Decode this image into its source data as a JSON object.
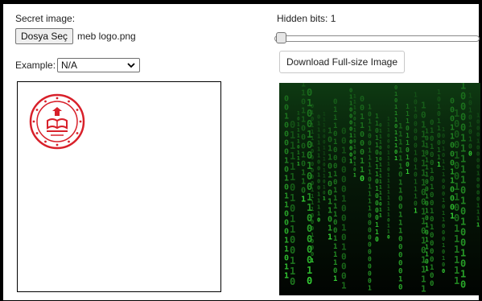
{
  "secret_section": {
    "label": "Secret image:",
    "file_button_label": "Dosya Seç",
    "file_name": "meb logo.png"
  },
  "example": {
    "label": "Example:",
    "selected": "N/A"
  },
  "hidden_bits": {
    "label": "Hidden bits: 1",
    "slider_value": 1,
    "slider_min": 1,
    "slider_max": 8
  },
  "download_button_label": "Download Full-size Image",
  "colors": {
    "matrix_green": "#33cc33",
    "seal_red": "#d8202a"
  },
  "icons": {
    "select_arrow": "chevron-down-icon",
    "seal": "ministry-seal-logo"
  }
}
